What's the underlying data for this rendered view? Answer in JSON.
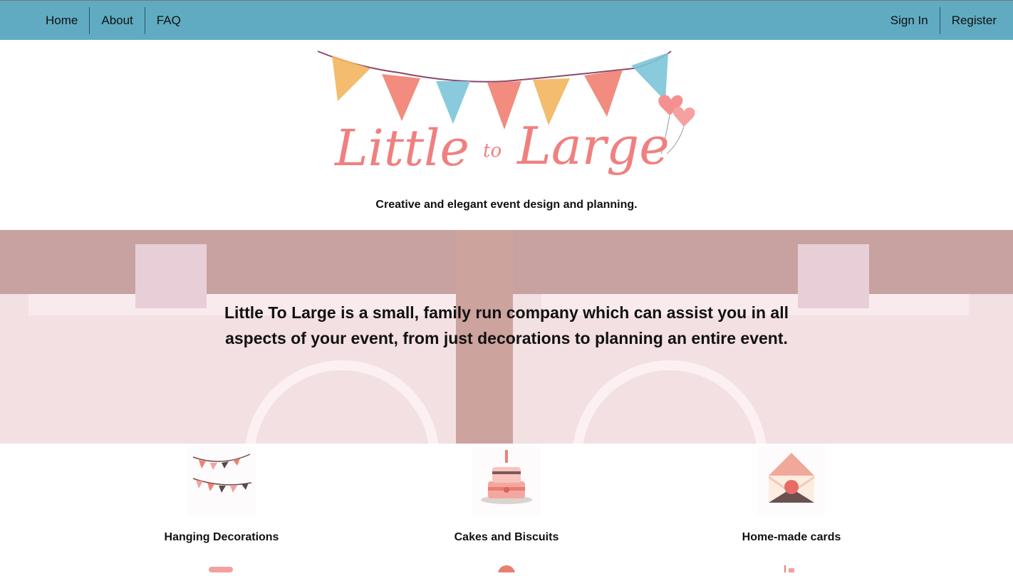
{
  "nav": {
    "left": [
      "Home",
      "About",
      "FAQ"
    ],
    "right": [
      "Sign In",
      "Register"
    ]
  },
  "logo": {
    "word1": "Little",
    "word2": "to",
    "word3": "Large"
  },
  "tagline": "Creative and elegant event design and planning.",
  "hero": {
    "text": "Little To Large is a small, family run company which can assist you in all aspects of your event, from just decorations to planning an entire event."
  },
  "services": [
    {
      "label": "Hanging Decorations",
      "icon": "bunting-icon"
    },
    {
      "label": "Cakes and Biscuits",
      "icon": "cake-icon"
    },
    {
      "label": "Home-made cards",
      "icon": "envelope-icon"
    }
  ],
  "colors": {
    "nav": "#60abc2",
    "logo": "#f08080",
    "bunting_blue": "#7cc4d8",
    "bunting_orange": "#f2b55e"
  }
}
